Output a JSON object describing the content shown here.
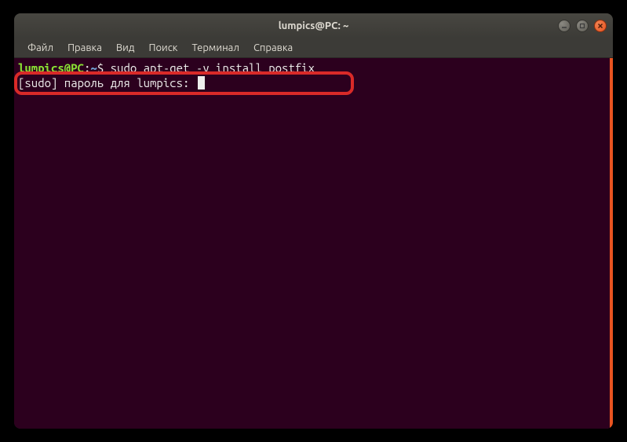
{
  "titlebar": {
    "title": "lumpics@PC: ~"
  },
  "window_controls": {
    "minimize_icon": "minimize",
    "maximize_icon": "maximize",
    "close_icon": "close"
  },
  "menubar": {
    "items": [
      {
        "label": "Файл"
      },
      {
        "label": "Правка"
      },
      {
        "label": "Вид"
      },
      {
        "label": "Поиск"
      },
      {
        "label": "Терминал"
      },
      {
        "label": "Справка"
      }
    ]
  },
  "terminal": {
    "prompt_user": "lumpics@PC",
    "prompt_colon": ":",
    "prompt_path": "~",
    "prompt_dollar": "$ ",
    "command": "sudo apt-get -y install postfix",
    "sudo_prompt": "[sudo] пароль для lumpics: "
  }
}
